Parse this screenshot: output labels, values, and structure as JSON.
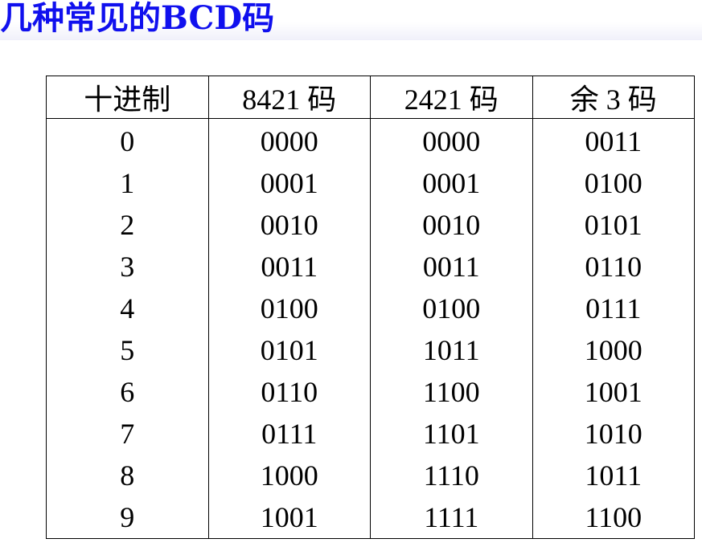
{
  "slide": {
    "title": "几种常见的BCD码"
  },
  "table": {
    "headers": [
      "十进制",
      "8421 码",
      "2421 码",
      "余 3 码"
    ],
    "rows": [
      [
        "0",
        "0000",
        "0000",
        "0011"
      ],
      [
        "1",
        "0001",
        "0001",
        "0100"
      ],
      [
        "2",
        "0010",
        "0010",
        "0101"
      ],
      [
        "3",
        "0011",
        "0011",
        "0110"
      ],
      [
        "4",
        "0100",
        "0100",
        "0111"
      ],
      [
        "5",
        "0101",
        "1011",
        "1000"
      ],
      [
        "6",
        "0110",
        "1100",
        "1001"
      ],
      [
        "7",
        "0111",
        "1101",
        "1010"
      ],
      [
        "8",
        "1000",
        "1110",
        "1011"
      ],
      [
        "9",
        "1001",
        "1111",
        "1100"
      ]
    ]
  },
  "colors": {
    "title": "#1010ee",
    "text": "#000000",
    "border": "#000000",
    "background": "#ffffff"
  }
}
